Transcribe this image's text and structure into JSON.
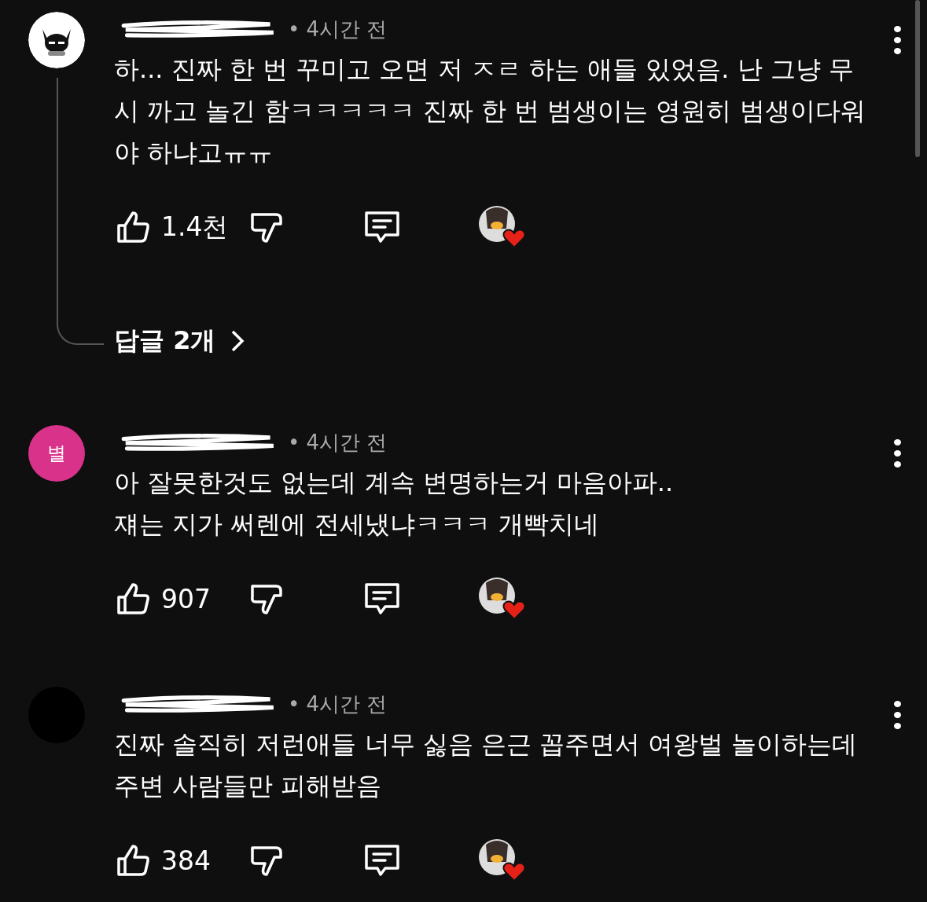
{
  "comments": [
    {
      "avatar": {
        "kind": "image"
      },
      "time": "• 4시간 전",
      "lines": [
        "하... 진짜 한 번 꾸미고 오면 저 ㅈㄹ 하는 애들 있었음. 난 그냥 무",
        "시 까고 놀긴 함ㅋㅋㅋㅋㅋ 진짜 한 번 범생이는 영원히 범생이다워",
        "야 하냐고ㅠㅠ"
      ],
      "likes": "1.4천",
      "creator_heart": true,
      "replies": "답글 2개"
    },
    {
      "avatar": {
        "kind": "letter",
        "letter": "별",
        "color": "#d9328a"
      },
      "time": "• 4시간 전",
      "lines": [
        "아 잘못한것도 없는데 계속 변명하는거 마음아파..",
        "쟤는 지가 써렌에 전세냈냐ㅋㅋㅋ 개빡치네"
      ],
      "likes": "907",
      "creator_heart": true
    },
    {
      "avatar": {
        "kind": "blank"
      },
      "time": "• 4시간 전",
      "lines": [
        "진짜 솔직히 저런애들 너무 싫음 은근 꼽주면서 여왕벌 놀이하는데",
        "주변 사람들만 피해받음"
      ],
      "likes": "384",
      "creator_heart": true
    }
  ]
}
